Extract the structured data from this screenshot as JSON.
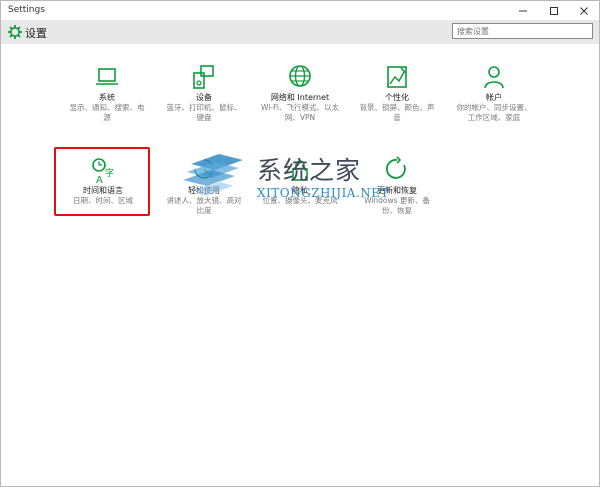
{
  "window": {
    "title": "Settings"
  },
  "header": {
    "title": "设置"
  },
  "search": {
    "placeholder": "搜索设置"
  },
  "tiles": [
    {
      "name": "系统",
      "desc": "显示、通知、搜索、电源",
      "icon": "laptop-icon"
    },
    {
      "name": "设备",
      "desc": "蓝牙、打印机、鼠标、键盘",
      "icon": "devices-icon"
    },
    {
      "name": "网络和 Internet",
      "desc": "Wi-Fi、飞行模式、以太网、VPN",
      "icon": "globe-icon"
    },
    {
      "name": "个性化",
      "desc": "背景、锁屏、颜色、声音",
      "icon": "personalization-icon"
    },
    {
      "name": "帐户",
      "desc": "你的帐户、同步设置、工作区域、家庭",
      "icon": "person-icon"
    },
    {
      "name": "时间和语言",
      "desc": "日期、时间、区域",
      "icon": "time-language-icon"
    },
    {
      "name": "轻松使用",
      "desc": "讲述人、放大镜、高对比度",
      "icon": "ease-of-access-icon"
    },
    {
      "name": "隐私",
      "desc": "位置、摄像头、麦克风",
      "icon": "lock-icon"
    },
    {
      "name": "更新和恢复",
      "desc": "Windows 更新、备份、恢复",
      "icon": "update-icon"
    }
  ],
  "watermark": {
    "cn": "系统之家",
    "en": "XITONGZHIJIA.NET"
  },
  "colors": {
    "accent": "#0e9a3c",
    "highlight": "#e01010"
  }
}
